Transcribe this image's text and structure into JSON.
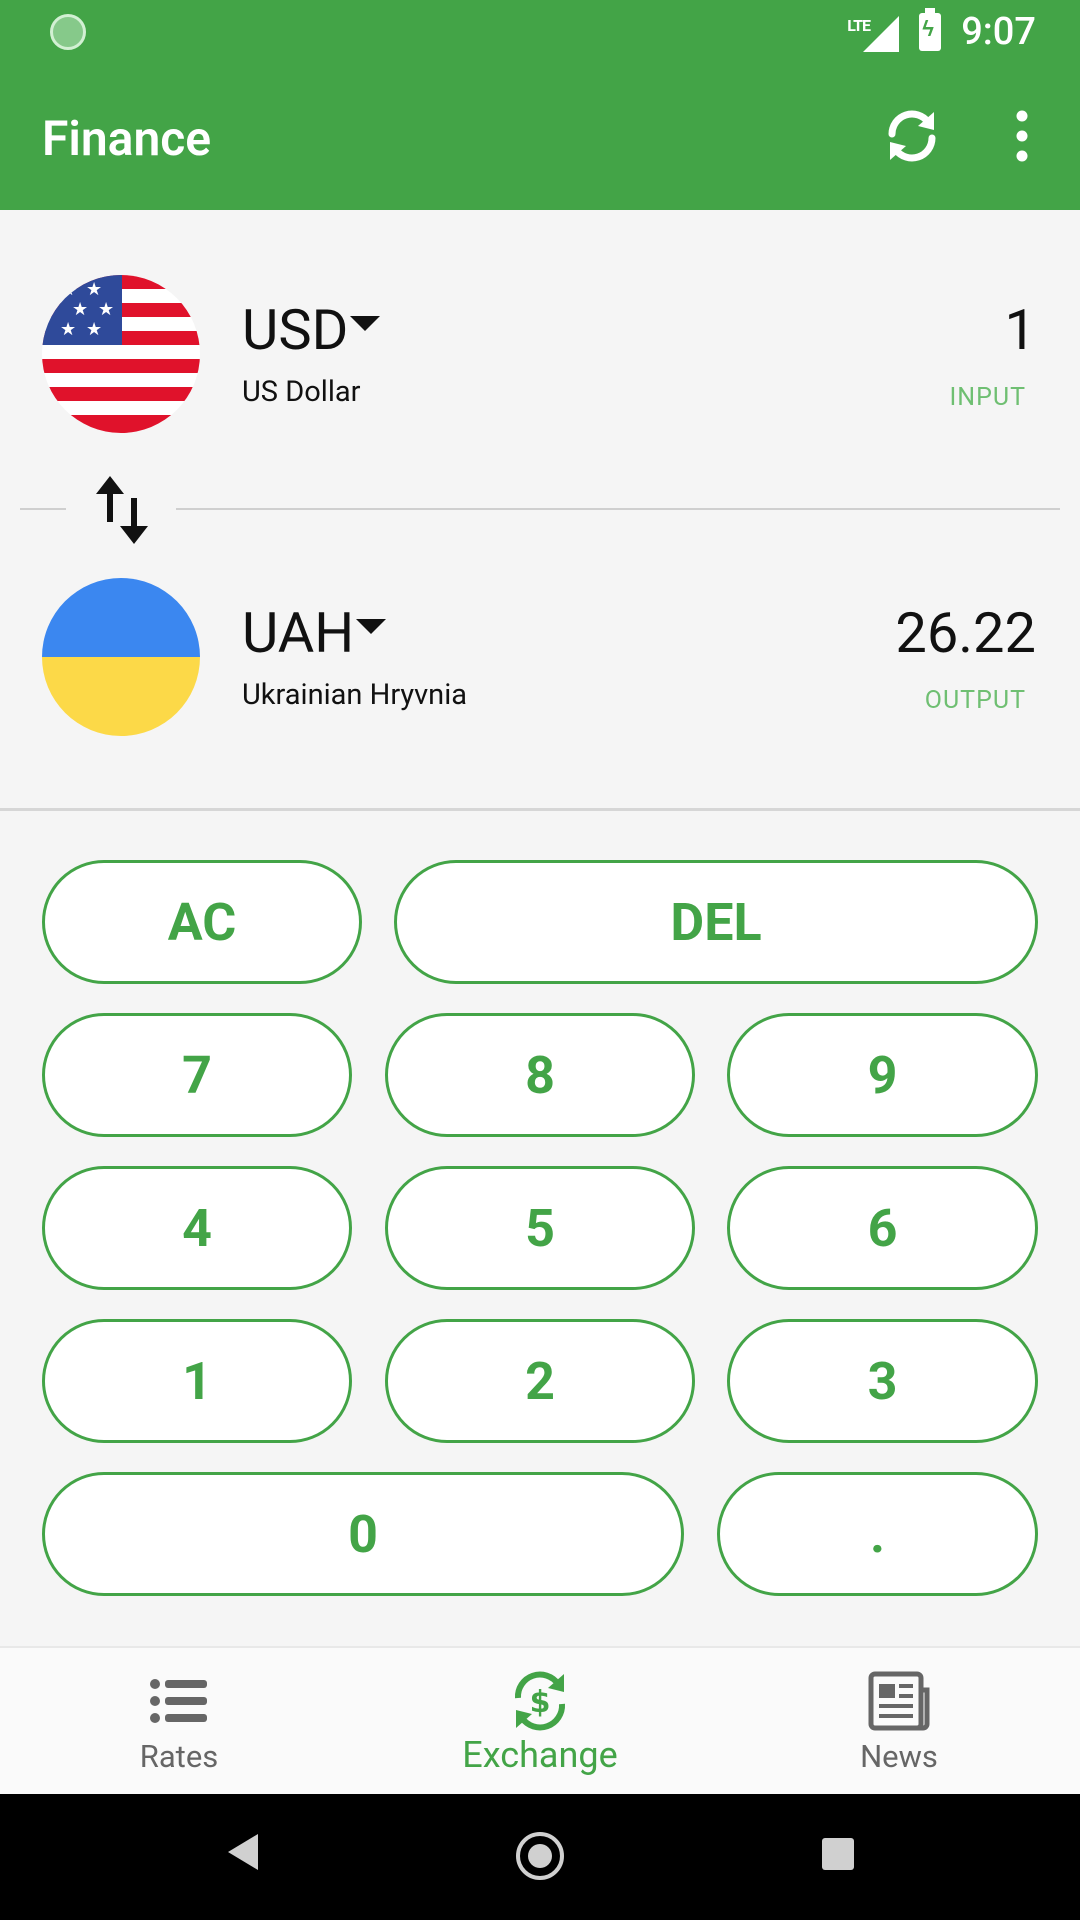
{
  "status_bar": {
    "network": "LTE",
    "time": "9:07"
  },
  "app_bar": {
    "title": "Finance"
  },
  "converter": {
    "from": {
      "code": "USD",
      "name": "US Dollar",
      "amount": "1",
      "role": "INPUT",
      "flag": "us-flag"
    },
    "to": {
      "code": "UAH",
      "name": "Ukrainian Hryvnia",
      "amount": "26.22",
      "role": "OUTPUT",
      "flag": "ua-flag"
    }
  },
  "keypad": {
    "ac": "AC",
    "del": "DEL",
    "k7": "7",
    "k8": "8",
    "k9": "9",
    "k4": "4",
    "k5": "5",
    "k6": "6",
    "k1": "1",
    "k2": "2",
    "k3": "3",
    "k0": "0",
    "dot": "."
  },
  "bottom_nav": {
    "items": [
      {
        "label": "Rates",
        "icon": "list-icon",
        "active": false
      },
      {
        "label": "Exchange",
        "icon": "currency-exchange-icon",
        "active": true
      },
      {
        "label": "News",
        "icon": "newspaper-icon",
        "active": false
      }
    ]
  },
  "colors": {
    "primary": "#43a447",
    "output_label": "#6fbf72"
  }
}
